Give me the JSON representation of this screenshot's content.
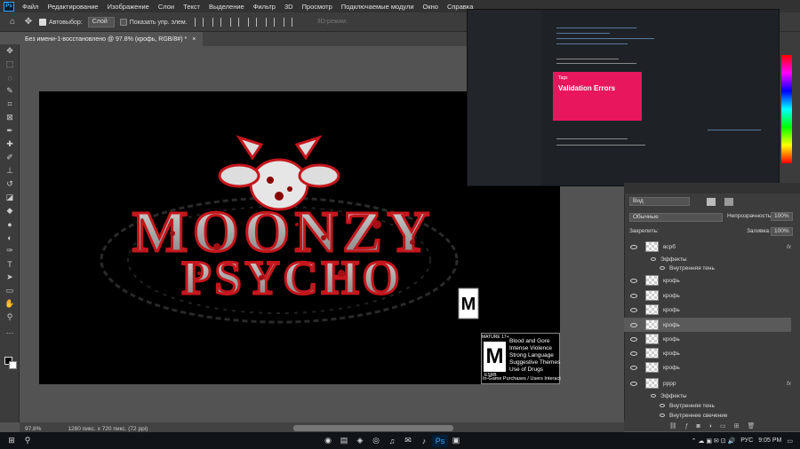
{
  "menubar": {
    "logo": "Ps",
    "items": [
      "Файл",
      "Редактирование",
      "Изображение",
      "Слои",
      "Текст",
      "Выделение",
      "Фильтр",
      "3D",
      "Просмотр",
      "Подключаемые модули",
      "Окно",
      "Справка"
    ]
  },
  "options": {
    "autoselect_label": "Автовыбор:",
    "autoselect_value": "Слой",
    "show_controls_label": "Показать упр. элем.",
    "mode_3d": "3D-режим:"
  },
  "document": {
    "tab_title": "Без имени-1-восстановлено @ 97.8% (крофь, RGB/8#) *",
    "close": "×"
  },
  "status": {
    "zoom": "97.8%",
    "size": "1280 пикс. x 720 пикс. (72 ppi)"
  },
  "artwork": {
    "line1": "MOONZY",
    "line2": "PSYCHO",
    "rating_letter": "M",
    "rating_top": "MATURE 17+",
    "rating_brand": "ESRB",
    "descriptors": [
      "Blood and Gore",
      "Intense Violence",
      "Strong Language",
      "Suggestive Themes",
      "Use of Drugs"
    ],
    "footer": "In-Game Purchases / Users Interact"
  },
  "overlay": {
    "card_title": "Validation Errors",
    "card_tag": "Tags"
  },
  "layers_panel": {
    "search_value": "Вид",
    "blend_mode": "Обычные",
    "opacity_label": "Непрозрачность:",
    "opacity_value": "100%",
    "lock_label": "Закрепить:",
    "fill_label": "Заливка:",
    "fill_value": "100%",
    "fx": "fx",
    "layers": [
      {
        "name": "всрб",
        "has_fx": true
      },
      {
        "name": "Эффекты",
        "sub": true
      },
      {
        "name": "Внутренняя тень",
        "sub": true
      },
      {
        "name": "крофь"
      },
      {
        "name": "крофь"
      },
      {
        "name": "крофь"
      },
      {
        "name": "крофь",
        "selected": true
      },
      {
        "name": "крофь"
      },
      {
        "name": "крофь"
      },
      {
        "name": "крофь"
      },
      {
        "name": "рррр",
        "has_fx": true
      },
      {
        "name": "Эффекты",
        "sub": true
      },
      {
        "name": "Внутренняя тень",
        "sub": true
      },
      {
        "name": "Внутреннее свечение",
        "sub": true
      }
    ]
  },
  "taskbar": {
    "lang": "РУС",
    "time": "9:05 PM"
  },
  "colors": {
    "accent_blood": "#c4161c",
    "ps_blue": "#31a8ff",
    "card_pink": "#e8175d"
  }
}
